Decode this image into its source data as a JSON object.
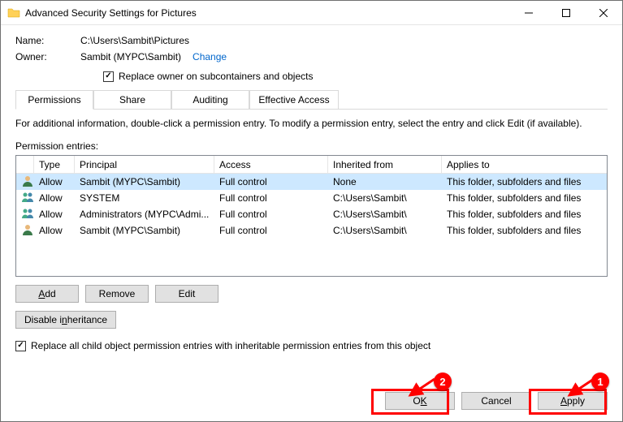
{
  "window": {
    "title": "Advanced Security Settings for Pictures"
  },
  "fields": {
    "name_label": "Name:",
    "name_value": "C:\\Users\\Sambit\\Pictures",
    "owner_label": "Owner:",
    "owner_value": "Sambit (MYPC\\Sambit)",
    "change_link": "Change",
    "replace_owner_label": "Replace owner on subcontainers and objects"
  },
  "tabs": [
    {
      "label": "Permissions",
      "active": true
    },
    {
      "label": "Share",
      "active": false
    },
    {
      "label": "Auditing",
      "active": false
    },
    {
      "label": "Effective Access",
      "active": false
    }
  ],
  "info_text": "For additional information, double-click a permission entry. To modify a permission entry, select the entry and click Edit (if available).",
  "entries_label": "Permission entries:",
  "columns": {
    "type": "Type",
    "principal": "Principal",
    "access": "Access",
    "inherited": "Inherited from",
    "applies": "Applies to"
  },
  "rows": [
    {
      "type": "Allow",
      "principal": "Sambit (MYPC\\Sambit)",
      "access": "Full control",
      "inherited": "None",
      "applies": "This folder, subfolders and files",
      "selected": true
    },
    {
      "type": "Allow",
      "principal": "SYSTEM",
      "access": "Full control",
      "inherited": "C:\\Users\\Sambit\\",
      "applies": "This folder, subfolders and files",
      "selected": false
    },
    {
      "type": "Allow",
      "principal": "Administrators (MYPC\\Admi...",
      "access": "Full control",
      "inherited": "C:\\Users\\Sambit\\",
      "applies": "This folder, subfolders and files",
      "selected": false
    },
    {
      "type": "Allow",
      "principal": "Sambit (MYPC\\Sambit)",
      "access": "Full control",
      "inherited": "C:\\Users\\Sambit\\",
      "applies": "This folder, subfolders and files",
      "selected": false
    }
  ],
  "buttons": {
    "add": "Add",
    "remove": "Remove",
    "edit": "Edit",
    "disable_inherit": "Disable inheritance"
  },
  "replace_child_label": "Replace all child object permission entries with inheritable permission entries from this object",
  "dialog": {
    "ok": "OK",
    "cancel": "Cancel",
    "apply": "Apply"
  },
  "annotations": {
    "num1": "1",
    "num2": "2"
  }
}
